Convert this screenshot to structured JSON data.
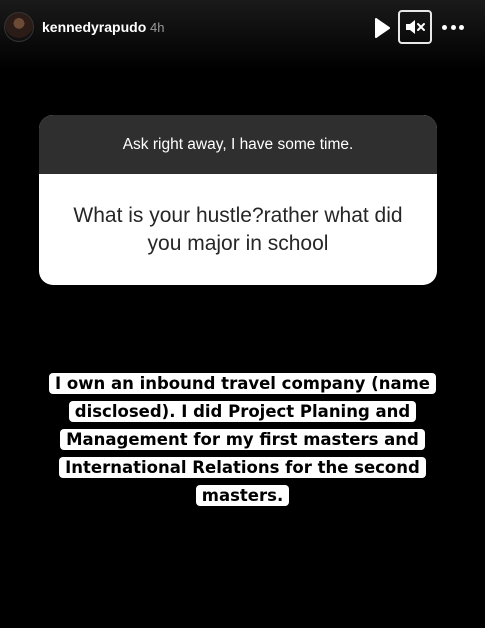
{
  "header": {
    "username": "kennedyrapudo",
    "time": "4h"
  },
  "icons": {
    "play": "play-icon",
    "mute": "speaker-muted-icon",
    "more": "more-options-icon"
  },
  "question_sticker": {
    "prompt": "Ask right away, I have some time.",
    "question": "What is your hustle?rather what did you major in school"
  },
  "answer_text": "I own an inbound travel company (name disclosed). I did Project Planing and Management for my first masters and International Relations for the second masters."
}
